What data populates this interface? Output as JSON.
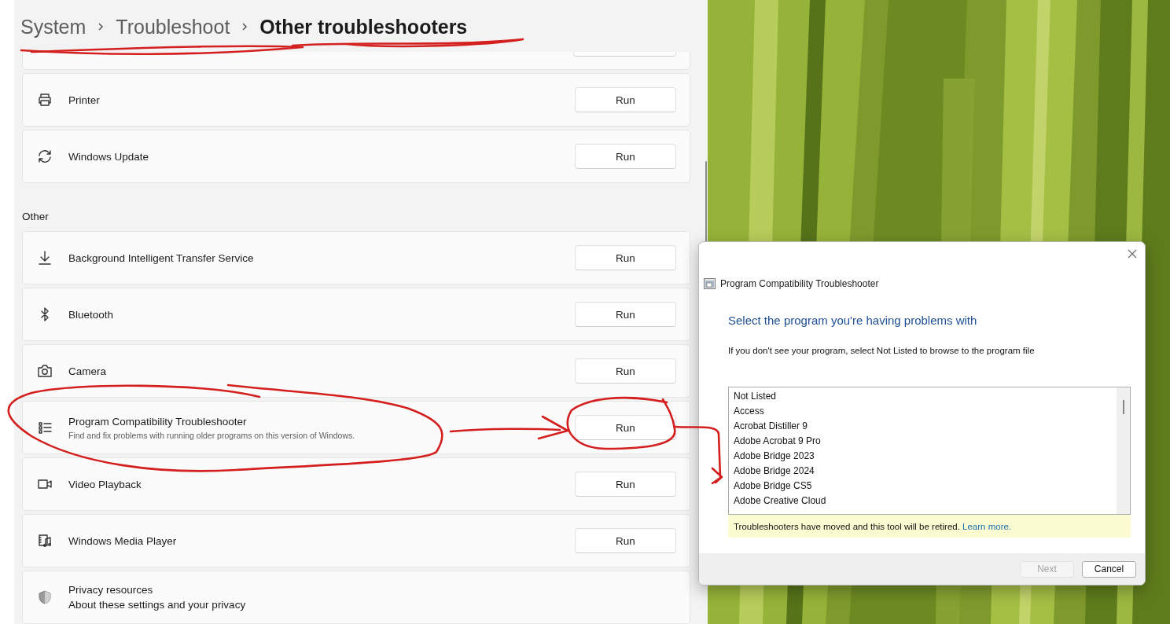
{
  "breadcrumb": [
    {
      "label": "System",
      "current": false
    },
    {
      "label": "Troubleshoot",
      "current": false
    },
    {
      "label": "Other troubleshooters",
      "current": true
    }
  ],
  "rows": [
    {
      "kind": "partial"
    },
    {
      "kind": "troubleshooter",
      "title": "Printer",
      "button": "Run"
    },
    {
      "kind": "troubleshooter",
      "title": "Windows Update",
      "button": "Run"
    },
    {
      "kind": "section",
      "title": "Other"
    },
    {
      "kind": "troubleshooter",
      "title": "Background Intelligent Transfer Service",
      "button": "Run"
    },
    {
      "kind": "troubleshooter",
      "title": "Bluetooth",
      "button": "Run"
    },
    {
      "kind": "troubleshooter",
      "title": "Camera",
      "button": "Run"
    },
    {
      "kind": "troubleshooter",
      "title": "Program Compatibility Troubleshooter",
      "description": "Find and fix problems with running older programs on this version of Windows.",
      "button": "Run"
    },
    {
      "kind": "troubleshooter",
      "title": "Video Playback",
      "button": "Run"
    },
    {
      "kind": "troubleshooter",
      "title": "Windows Media Player",
      "button": "Run"
    },
    {
      "kind": "link",
      "title": "Privacy resources",
      "subtitle": "About these settings and your privacy"
    }
  ],
  "dialog": {
    "title": "Program Compatibility Troubleshooter",
    "heading": "Select the program you're having problems with",
    "instruction": "If you don't see your program, select Not Listed to browse to the program file",
    "programs": [
      {
        "name": "Not Listed",
        "selected": false
      },
      {
        "name": "Access",
        "selected": false
      },
      {
        "name": "Acrobat Distiller 9",
        "selected": false
      },
      {
        "name": "Adobe Acrobat 9 Pro",
        "selected": false
      },
      {
        "name": "Adobe Bridge 2023",
        "selected": false
      },
      {
        "name": "Adobe Bridge 2024",
        "selected": false
      },
      {
        "name": "Adobe Bridge CS5",
        "selected": false
      },
      {
        "name": "Adobe Creative Cloud",
        "selected": false
      }
    ],
    "notice": {
      "text": "Troubleshooters have moved and this tool will be retired.",
      "link": "Learn more."
    },
    "buttons": [
      {
        "label": "Next",
        "disabled": true
      },
      {
        "label": "Cancel",
        "disabled": false
      }
    ]
  }
}
